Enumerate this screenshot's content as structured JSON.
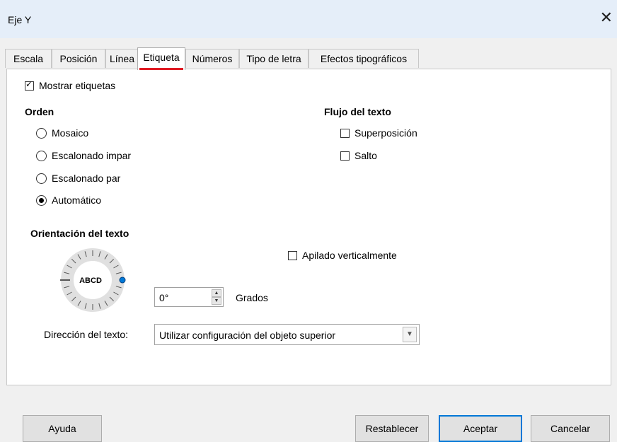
{
  "window": {
    "title": "Eje Y"
  },
  "tabs": [
    {
      "label": "Escala"
    },
    {
      "label": "Posición"
    },
    {
      "label": "Línea"
    },
    {
      "label": "Etiqueta"
    },
    {
      "label": "Números"
    },
    {
      "label": "Tipo de letra"
    },
    {
      "label": "Efectos tipográficos"
    }
  ],
  "active_tab": "Etiqueta",
  "show_labels": {
    "label": "Mostrar etiquetas",
    "checked": true
  },
  "order": {
    "heading": "Orden",
    "options": [
      {
        "label": "Mosaico",
        "checked": false
      },
      {
        "label": "Escalonado impar",
        "checked": false
      },
      {
        "label": "Escalonado par",
        "checked": false
      },
      {
        "label": "Automático",
        "checked": true
      }
    ]
  },
  "text_flow": {
    "heading": "Flujo del texto",
    "overlap": {
      "label": "Superposición",
      "checked": false
    },
    "wrap": {
      "label": "Salto",
      "checked": false
    }
  },
  "orientation": {
    "heading": "Orientación del texto",
    "dial_text": "ABCD",
    "stacked": {
      "label": "Apilado verticalmente",
      "checked": false
    },
    "degrees_value": "0°",
    "degrees_label": "Grados"
  },
  "text_direction": {
    "label": "Dirección del texto:",
    "value": "Utilizar configuración del objeto superior"
  },
  "buttons": {
    "help": "Ayuda",
    "reset": "Restablecer",
    "ok": "Aceptar",
    "cancel": "Cancelar"
  },
  "colors": {
    "titlebar": "#e5eef9",
    "accent": "#0078d7",
    "tab_underline": "#e01b24"
  }
}
